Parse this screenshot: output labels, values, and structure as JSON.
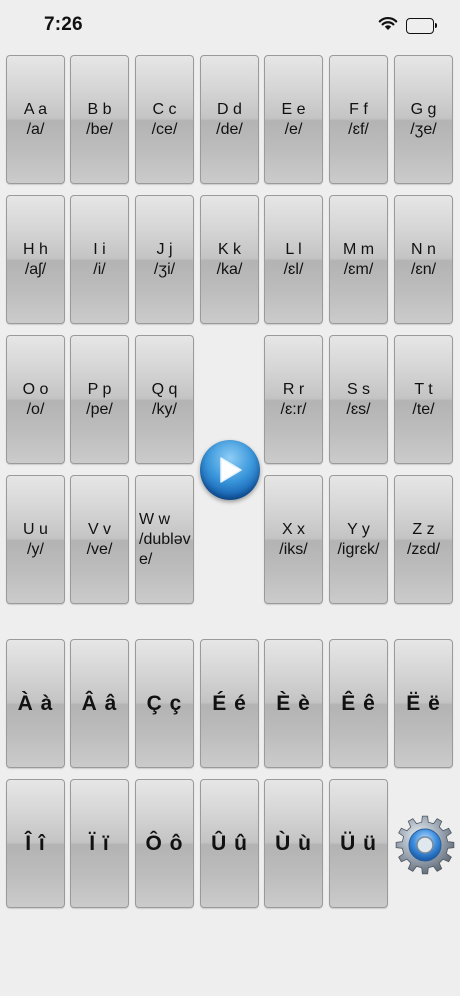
{
  "status_bar": {
    "time": "7:26",
    "icons": [
      "wifi-icon",
      "battery-icon"
    ]
  },
  "letters": [
    {
      "letter": "A a",
      "ipa": "/a/"
    },
    {
      "letter": "B b",
      "ipa": "/be/"
    },
    {
      "letter": "C c",
      "ipa": "/ce/"
    },
    {
      "letter": "D d",
      "ipa": "/de/"
    },
    {
      "letter": "E e",
      "ipa": "/e/"
    },
    {
      "letter": "F f",
      "ipa": "/ɛf/"
    },
    {
      "letter": "G g",
      "ipa": "/ʒe/"
    },
    {
      "letter": "H h",
      "ipa": "/aʃ/"
    },
    {
      "letter": "I i",
      "ipa": "/i/"
    },
    {
      "letter": "J j",
      "ipa": "/ʒi/"
    },
    {
      "letter": "K k",
      "ipa": "/ka/"
    },
    {
      "letter": "L l",
      "ipa": "/ɛl/"
    },
    {
      "letter": "M m",
      "ipa": "/ɛm/"
    },
    {
      "letter": "N n",
      "ipa": "/ɛn/"
    },
    {
      "letter": "O o",
      "ipa": "/o/"
    },
    {
      "letter": "P p",
      "ipa": "/pe/"
    },
    {
      "letter": "Q q",
      "ipa": "/ky/"
    },
    {
      "letter": "R r",
      "ipa": "/ɛ:r/"
    },
    {
      "letter": "S s",
      "ipa": "/ɛs/"
    },
    {
      "letter": "T t",
      "ipa": "/te/"
    },
    {
      "letter": "U u",
      "ipa": "/y/"
    },
    {
      "letter": "V v",
      "ipa": "/ve/"
    },
    {
      "letter": "W w",
      "ipa": "/dubləve/"
    },
    {
      "letter": "X x",
      "ipa": "/iks/"
    },
    {
      "letter": "Y y",
      "ipa": "/igrɛk/"
    },
    {
      "letter": "Z z",
      "ipa": "/zɛd/"
    }
  ],
  "accents": [
    "À à",
    "Â â",
    "Ç ç",
    "É é",
    "È è",
    "Ê ê",
    "Ë ë",
    "Î î",
    "Ï ï",
    "Ô ô",
    "Û û",
    "Ù ù",
    "Ü ü"
  ],
  "controls": {
    "play": "play-icon",
    "settings": "gear-icon"
  }
}
